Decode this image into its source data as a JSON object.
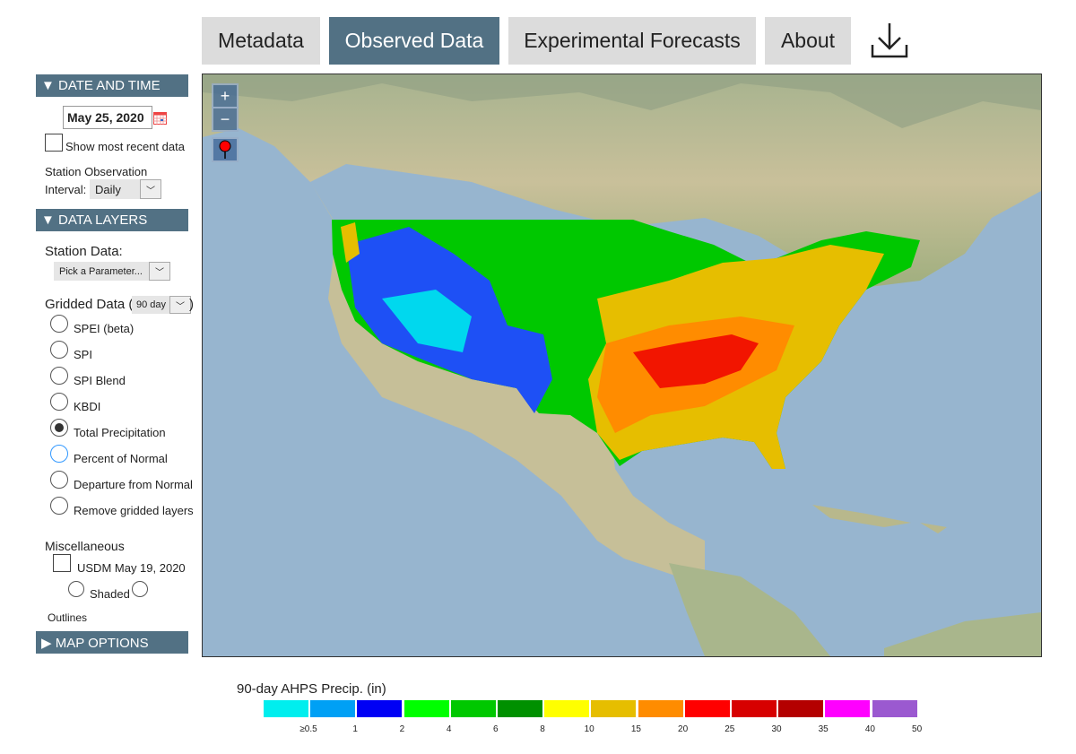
{
  "nav": {
    "tabs": [
      {
        "label": "Metadata",
        "active": false
      },
      {
        "label": "Observed Data",
        "active": true
      },
      {
        "label": "Experimental Forecasts",
        "active": false
      },
      {
        "label": "About",
        "active": false
      }
    ],
    "download_icon": "download-icon"
  },
  "sidebar": {
    "date_section": {
      "title": "▼ DATE AND TIME",
      "date": "May 25, 2020",
      "calendar_icon": "calendar-icon",
      "recent_label": "Show most recent data",
      "interval_label1": "Station Observation",
      "interval_label2": "Interval:",
      "interval_value": "Daily"
    },
    "layers_section": {
      "title": "▼ DATA LAYERS",
      "station_label": "Station Data:",
      "station_value": "Pick a Parameter...",
      "gridded_label": "Gridded Data (",
      "gridded_close": ")",
      "gridded_value": "90 day",
      "options": [
        {
          "label": "SPEI (beta)",
          "selected": false
        },
        {
          "label": "SPI",
          "selected": false
        },
        {
          "label": "SPI Blend",
          "selected": false
        },
        {
          "label": "KBDI",
          "selected": false
        },
        {
          "label": "Total Precipitation",
          "selected": true
        },
        {
          "label": "Percent of Normal",
          "selected": false
        },
        {
          "label": "Departure from Normal",
          "selected": false
        },
        {
          "label": "Remove gridded layers",
          "selected": false
        }
      ],
      "misc_label": "Miscellaneous",
      "usdm_label": "USDM May 19, 2020",
      "shaded_label": "Shaded",
      "outlines_label": "Outlines"
    },
    "map_options": {
      "title": "▶ MAP OPTIONS"
    }
  },
  "map": {
    "zoom_in": "+",
    "zoom_out": "−",
    "marker_icon": "map-pin-icon"
  },
  "legend": {
    "title": "90-day AHPS Precip. (in)",
    "colors": [
      "#00eeee",
      "#00a0f5",
      "#0000f5",
      "#00ff00",
      "#00c800",
      "#009000",
      "#ffff00",
      "#e6be00",
      "#ff8c00",
      "#ff0000",
      "#d70000",
      "#b40000",
      "#ff00ff",
      "#9b59d0"
    ],
    "labels": [
      "≥0.5",
      "1",
      "2",
      "4",
      "6",
      "8",
      "10",
      "15",
      "20",
      "25",
      "30",
      "35",
      "40",
      "50"
    ]
  }
}
